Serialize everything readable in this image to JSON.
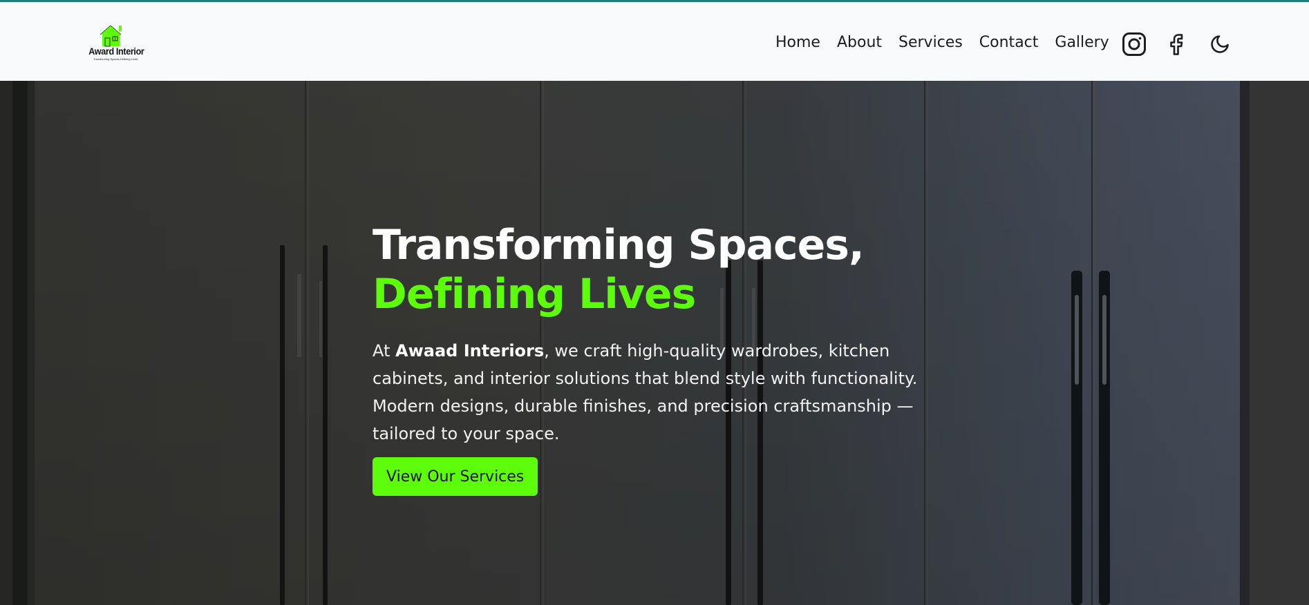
{
  "brand": {
    "name": "Award Interior",
    "tagline": "Transforming Spaces,Defining Lives",
    "logo_color": "#5dfc0a"
  },
  "nav": {
    "items": [
      {
        "label": "Home"
      },
      {
        "label": "About"
      },
      {
        "label": "Services"
      },
      {
        "label": "Contact"
      },
      {
        "label": "Gallery"
      }
    ]
  },
  "icons": {
    "instagram": "instagram-icon",
    "facebook": "facebook-icon",
    "theme": "moon-icon"
  },
  "hero": {
    "title_line1": "Transforming Spaces,",
    "title_line2": "Defining Lives",
    "desc_prefix": "At ",
    "desc_brand": "Awaad Interiors",
    "desc_rest": ", we craft high-quality wardrobes, kitchen cabinets, and interior solutions that blend style with functionality. Modern designs, durable finishes, and precision craftsmanship — tailored to your space.",
    "cta_label": "View Our Services"
  },
  "colors": {
    "accent": "#5dfc0a",
    "top_border": "#1f7f7c",
    "header_bg": "#f8f9fb",
    "text_dark": "#1d1d1f"
  }
}
